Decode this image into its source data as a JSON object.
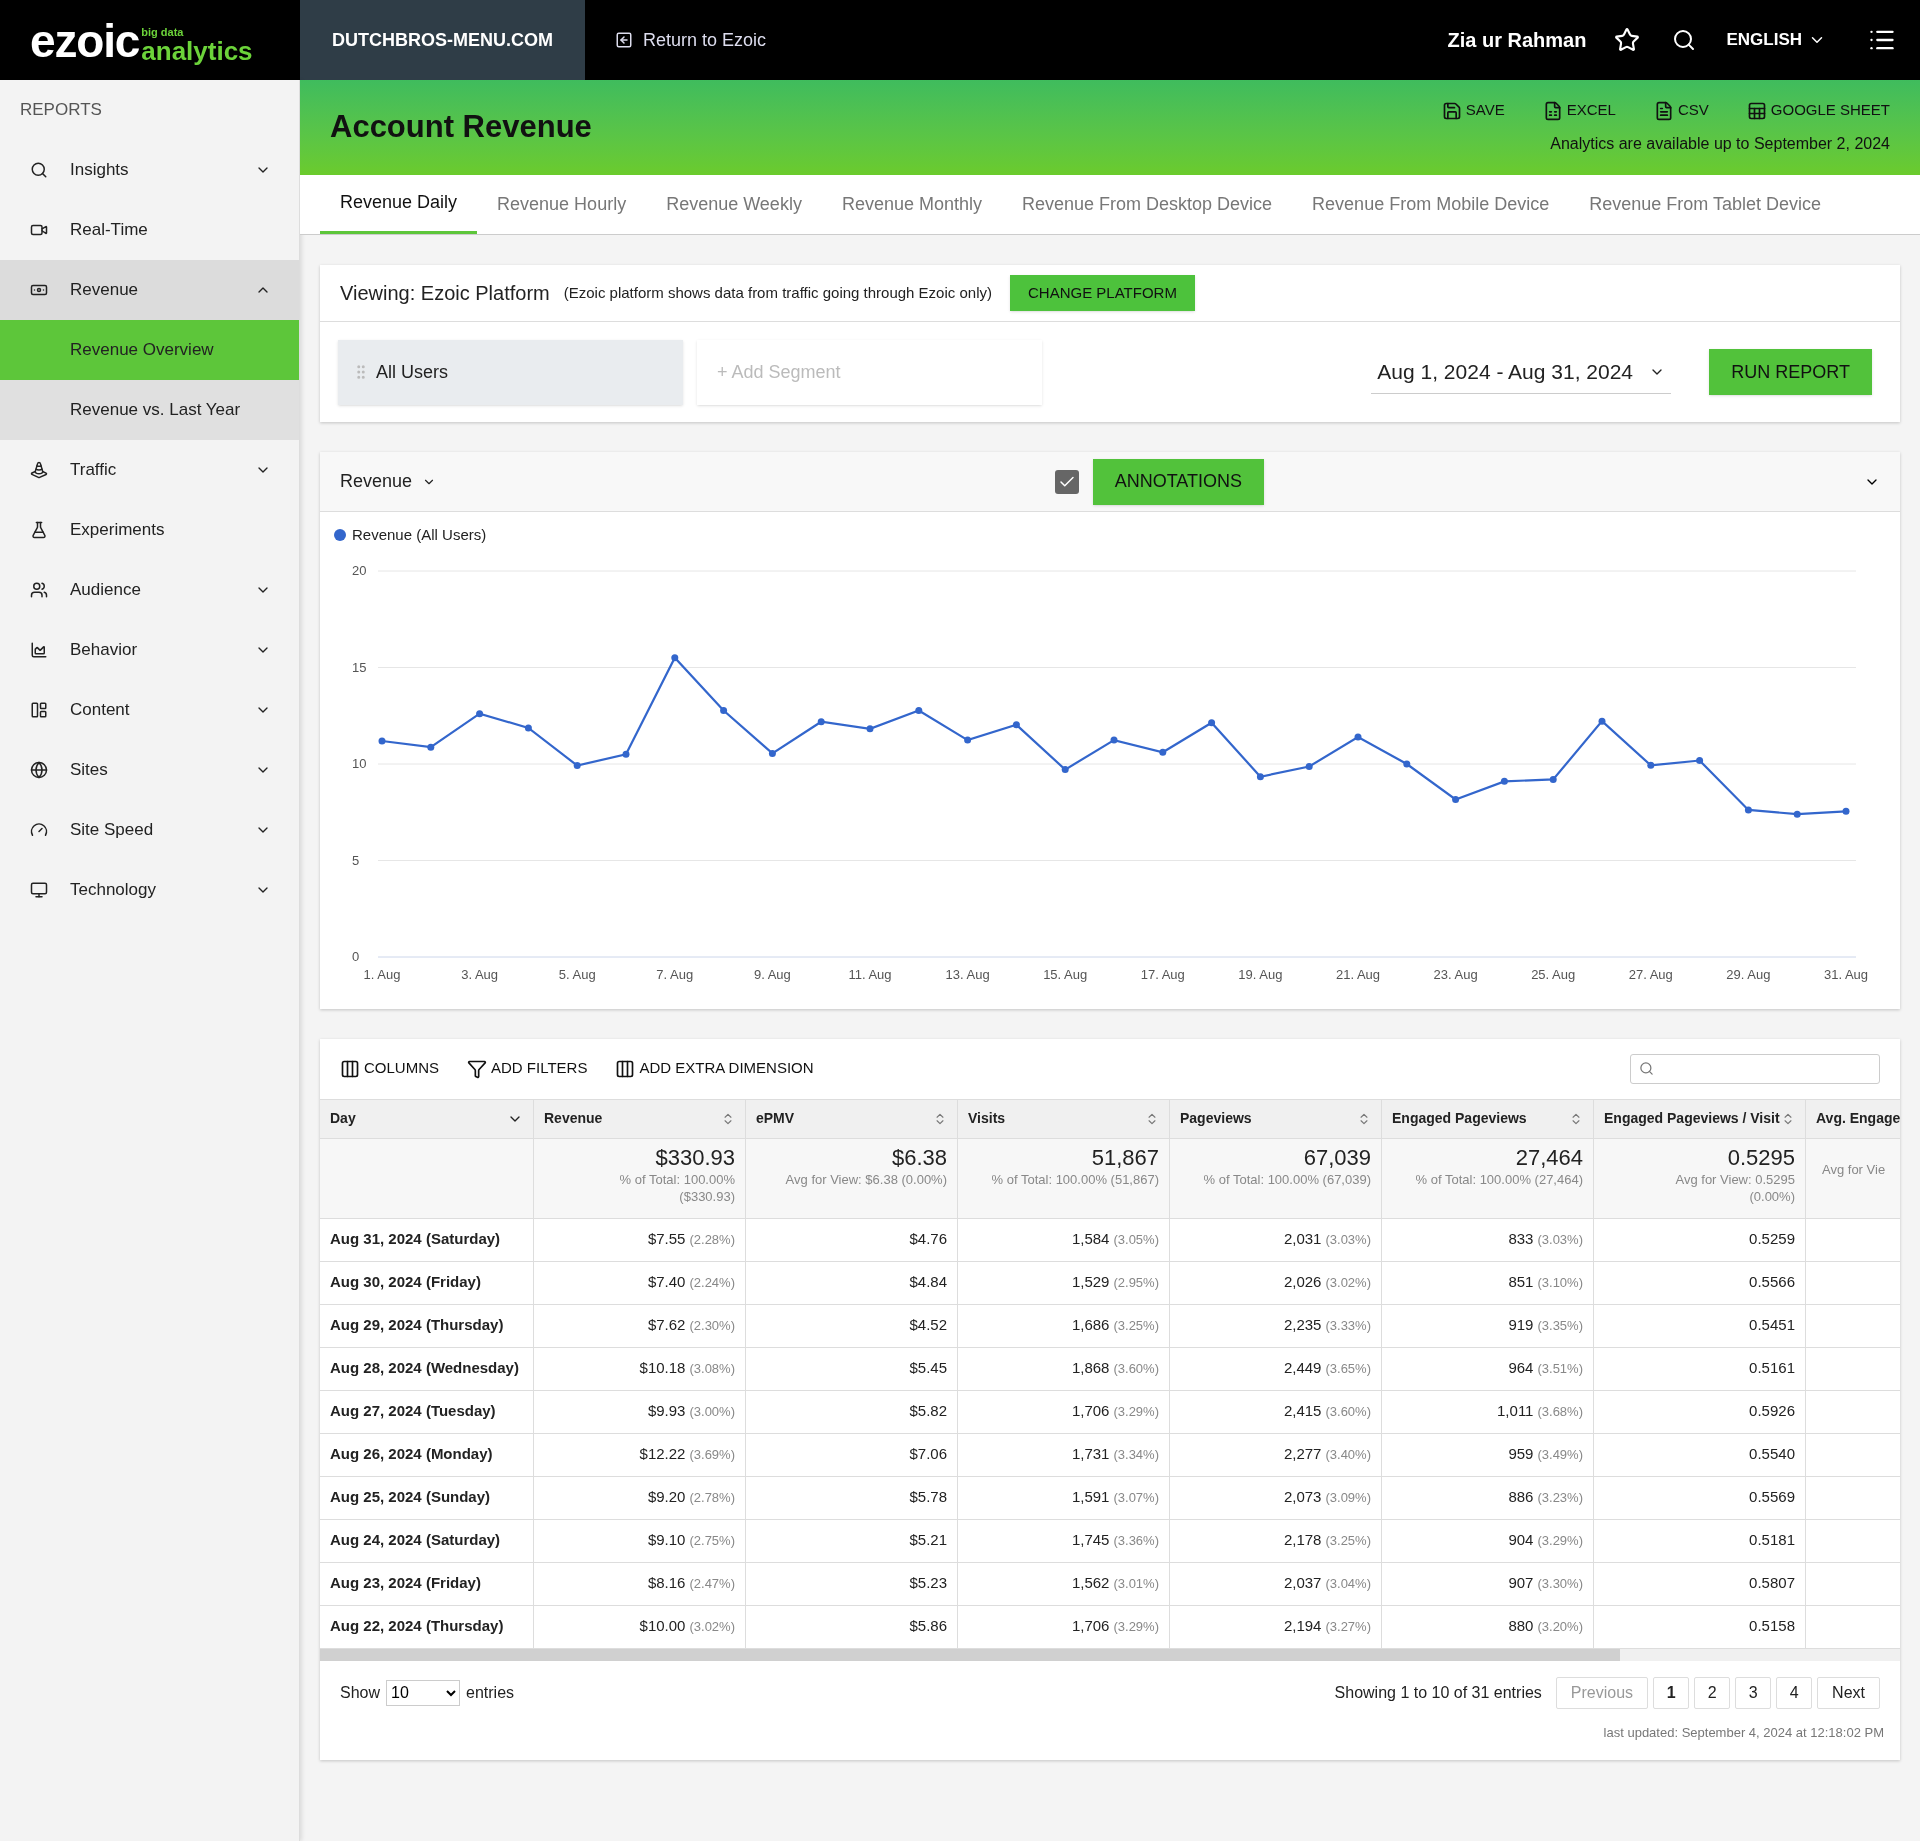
{
  "topbar": {
    "logo_word": "ezoic",
    "logo_small": "big data",
    "logo_sub": "analytics",
    "site": "DUTCHBROS-MENU.COM",
    "return_link": "Return to Ezoic",
    "user": "Zia ur Rahman",
    "language": "ENGLISH"
  },
  "sidebar": {
    "heading": "REPORTS",
    "items": [
      {
        "label": "Insights",
        "kind": "group",
        "expanded": false,
        "selected": false
      },
      {
        "label": "Real-Time",
        "kind": "link",
        "selected": false
      },
      {
        "label": "Revenue",
        "kind": "group",
        "expanded": true,
        "selected": true,
        "children": [
          {
            "label": "Revenue Overview",
            "selected": true
          },
          {
            "label": "Revenue vs. Last Year",
            "selected": false
          }
        ]
      },
      {
        "label": "Traffic",
        "kind": "group",
        "expanded": false,
        "selected": false
      },
      {
        "label": "Experiments",
        "kind": "link",
        "selected": false
      },
      {
        "label": "Audience",
        "kind": "group",
        "expanded": false,
        "selected": false
      },
      {
        "label": "Behavior",
        "kind": "group",
        "expanded": false,
        "selected": false
      },
      {
        "label": "Content",
        "kind": "group",
        "expanded": false,
        "selected": false
      },
      {
        "label": "Sites",
        "kind": "group",
        "expanded": false,
        "selected": false
      },
      {
        "label": "Site Speed",
        "kind": "group",
        "expanded": false,
        "selected": false
      },
      {
        "label": "Technology",
        "kind": "group",
        "expanded": false,
        "selected": false
      }
    ]
  },
  "header": {
    "title": "Account Revenue",
    "exports": [
      "SAVE",
      "EXCEL",
      "CSV",
      "GOOGLE SHEET"
    ],
    "availability": "Analytics are available up to September 2, 2024"
  },
  "tabs": [
    {
      "label": "Revenue Daily",
      "selected": true
    },
    {
      "label": "Revenue Hourly",
      "selected": false
    },
    {
      "label": "Revenue Weekly",
      "selected": false
    },
    {
      "label": "Revenue Monthly",
      "selected": false
    },
    {
      "label": "Revenue From Desktop Device",
      "selected": false
    },
    {
      "label": "Revenue From Mobile Device",
      "selected": false
    },
    {
      "label": "Revenue From Tablet Device",
      "selected": false
    }
  ],
  "platform": {
    "viewing": "Viewing: Ezoic Platform",
    "note": "(Ezoic platform shows data from traffic going through Ezoic only)",
    "button": "CHANGE PLATFORM"
  },
  "segments": {
    "active": "All Users",
    "add_placeholder": "+ Add Segment",
    "date_range": "Aug 1, 2024 - Aug 31, 2024",
    "run": "RUN REPORT"
  },
  "chart_panel": {
    "metric": "Revenue",
    "annotations_checked": true,
    "annotations": "ANNOTATIONS",
    "chart_data": {
      "type": "line",
      "grid": true,
      "series": [
        {
          "name": "Revenue (All Users)",
          "color": "#3366cc",
          "marker": true,
          "values": [
            11.19,
            10.87,
            12.61,
            11.87,
            9.92,
            10.5,
            15.51,
            12.77,
            10.55,
            12.19,
            11.82,
            12.77,
            11.24,
            12.03,
            9.71,
            11.24,
            10.61,
            12.14,
            9.34,
            9.87,
            11.4,
            10.0,
            8.16,
            9.1,
            9.2,
            12.22,
            9.93,
            10.18,
            7.62,
            7.4,
            7.55
          ]
        }
      ],
      "categories": [
        "1. Aug",
        null,
        "3. Aug",
        null,
        "5. Aug",
        null,
        "7. Aug",
        null,
        "9. Aug",
        null,
        "11. Aug",
        null,
        "13. Aug",
        null,
        "15. Aug",
        null,
        "17. Aug",
        null,
        "19. Aug",
        null,
        "21. Aug",
        null,
        "23. Aug",
        null,
        "25. Aug",
        null,
        "27. Aug",
        null,
        "29. Aug",
        null,
        "31. Aug"
      ],
      "ylim": [
        0,
        20
      ],
      "yticks": [
        0,
        5,
        10,
        15,
        20
      ]
    }
  },
  "table_toolbar": [
    "COLUMNS",
    "ADD FILTERS",
    "ADD EXTRA DIMENSION"
  ],
  "table": {
    "columns": [
      "Day",
      "Revenue",
      "ePMV",
      "Visits",
      "Pageviews",
      "Engaged Pageviews",
      "Engaged Pageviews / Visit",
      "Avg. Engage"
    ],
    "totals": [
      {
        "value": "$330.93",
        "lines": [
          "% of Total: 100.00%",
          "($330.93)"
        ]
      },
      {
        "value": "$6.38",
        "lines": [
          "Avg for View: $6.38 (0.00%)"
        ]
      },
      {
        "value": "51,867",
        "lines": [
          "% of Total: 100.00% (51,867)"
        ]
      },
      {
        "value": "67,039",
        "lines": [
          "% of Total: 100.00% (67,039)"
        ]
      },
      {
        "value": "27,464",
        "lines": [
          "% of Total: 100.00% (27,464)"
        ]
      },
      {
        "value": "0.5295",
        "lines": [
          "Avg for View: 0.5295",
          "(0.00%)"
        ]
      },
      {
        "lines": [
          "Avg for Vie"
        ]
      }
    ],
    "rows": [
      {
        "day": "Aug 31, 2024 (Saturday)",
        "revenue": "$7.55",
        "revenue_pct": "(2.28%)",
        "epmv": "$4.76",
        "visits": "1,584",
        "visits_pct": "(3.05%)",
        "pageviews": "2,031",
        "pageviews_pct": "(3.03%)",
        "engaged": "833",
        "engaged_pct": "(3.03%)",
        "epv": "0.5259"
      },
      {
        "day": "Aug 30, 2024 (Friday)",
        "revenue": "$7.40",
        "revenue_pct": "(2.24%)",
        "epmv": "$4.84",
        "visits": "1,529",
        "visits_pct": "(2.95%)",
        "pageviews": "2,026",
        "pageviews_pct": "(3.02%)",
        "engaged": "851",
        "engaged_pct": "(3.10%)",
        "epv": "0.5566"
      },
      {
        "day": "Aug 29, 2024 (Thursday)",
        "revenue": "$7.62",
        "revenue_pct": "(2.30%)",
        "epmv": "$4.52",
        "visits": "1,686",
        "visits_pct": "(3.25%)",
        "pageviews": "2,235",
        "pageviews_pct": "(3.33%)",
        "engaged": "919",
        "engaged_pct": "(3.35%)",
        "epv": "0.5451"
      },
      {
        "day": "Aug 28, 2024 (Wednesday)",
        "revenue": "$10.18",
        "revenue_pct": "(3.08%)",
        "epmv": "$5.45",
        "visits": "1,868",
        "visits_pct": "(3.60%)",
        "pageviews": "2,449",
        "pageviews_pct": "(3.65%)",
        "engaged": "964",
        "engaged_pct": "(3.51%)",
        "epv": "0.5161"
      },
      {
        "day": "Aug 27, 2024 (Tuesday)",
        "revenue": "$9.93",
        "revenue_pct": "(3.00%)",
        "epmv": "$5.82",
        "visits": "1,706",
        "visits_pct": "(3.29%)",
        "pageviews": "2,415",
        "pageviews_pct": "(3.60%)",
        "engaged": "1,011",
        "engaged_pct": "(3.68%)",
        "epv": "0.5926"
      },
      {
        "day": "Aug 26, 2024 (Monday)",
        "revenue": "$12.22",
        "revenue_pct": "(3.69%)",
        "epmv": "$7.06",
        "visits": "1,731",
        "visits_pct": "(3.34%)",
        "pageviews": "2,277",
        "pageviews_pct": "(3.40%)",
        "engaged": "959",
        "engaged_pct": "(3.49%)",
        "epv": "0.5540"
      },
      {
        "day": "Aug 25, 2024 (Sunday)",
        "revenue": "$9.20",
        "revenue_pct": "(2.78%)",
        "epmv": "$5.78",
        "visits": "1,591",
        "visits_pct": "(3.07%)",
        "pageviews": "2,073",
        "pageviews_pct": "(3.09%)",
        "engaged": "886",
        "engaged_pct": "(3.23%)",
        "epv": "0.5569"
      },
      {
        "day": "Aug 24, 2024 (Saturday)",
        "revenue": "$9.10",
        "revenue_pct": "(2.75%)",
        "epmv": "$5.21",
        "visits": "1,745",
        "visits_pct": "(3.36%)",
        "pageviews": "2,178",
        "pageviews_pct": "(3.25%)",
        "engaged": "904",
        "engaged_pct": "(3.29%)",
        "epv": "0.5181"
      },
      {
        "day": "Aug 23, 2024 (Friday)",
        "revenue": "$8.16",
        "revenue_pct": "(2.47%)",
        "epmv": "$5.23",
        "visits": "1,562",
        "visits_pct": "(3.01%)",
        "pageviews": "2,037",
        "pageviews_pct": "(3.04%)",
        "engaged": "907",
        "engaged_pct": "(3.30%)",
        "epv": "0.5807"
      },
      {
        "day": "Aug 22, 2024 (Thursday)",
        "revenue": "$10.00",
        "revenue_pct": "(3.02%)",
        "epmv": "$5.86",
        "visits": "1,706",
        "visits_pct": "(3.29%)",
        "pageviews": "2,194",
        "pageviews_pct": "(3.27%)",
        "engaged": "880",
        "engaged_pct": "(3.20%)",
        "epv": "0.5158"
      }
    ]
  },
  "footer": {
    "show": "Show",
    "page_size": "10",
    "entries": "entries",
    "showing": "Showing 1 to 10 of 31 entries",
    "pages": [
      {
        "label": "Previous",
        "kind": "nav",
        "disabled": true,
        "selected": false
      },
      {
        "label": "1",
        "kind": "page",
        "selected": true
      },
      {
        "label": "2",
        "kind": "page",
        "selected": false
      },
      {
        "label": "3",
        "kind": "page",
        "selected": false
      },
      {
        "label": "4",
        "kind": "page",
        "selected": false
      },
      {
        "label": "Next",
        "kind": "nav",
        "disabled": false,
        "selected": false
      }
    ],
    "updated": "last updated: September 4, 2024 at 12:18:02 PM"
  }
}
